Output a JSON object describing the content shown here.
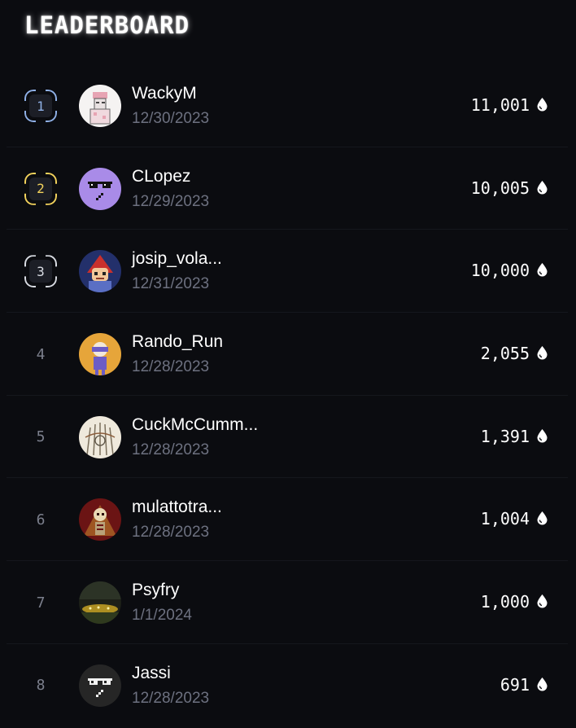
{
  "header": {
    "title": "LEADERBOARD"
  },
  "colors": {
    "background": "#0b0c10",
    "rank1_accent": "#8fb0e6",
    "rank2_accent": "#f2d25c",
    "rank3_accent": "#d9dce3",
    "muted_text": "#6d7180"
  },
  "entries": [
    {
      "rank": "1",
      "name": "WackyM",
      "date": "12/30/2023",
      "score": "11,001",
      "avatar_icon": "pixel-character-pink-cap-avatar"
    },
    {
      "rank": "2",
      "name": "CLopez",
      "date": "12/29/2023",
      "score": "10,005",
      "avatar_icon": "purple-sunglasses-face-avatar"
    },
    {
      "rank": "3",
      "name": "josip_vola...",
      "date": "12/31/2023",
      "score": "10,000",
      "avatar_icon": "cartoon-character-blue-avatar"
    },
    {
      "rank": "4",
      "name": "Rando_Run",
      "date": "12/28/2023",
      "score": "2,055",
      "avatar_icon": "orange-vr-figure-avatar"
    },
    {
      "rank": "5",
      "name": "CuckMcCumm...",
      "date": "12/28/2023",
      "score": "1,391",
      "avatar_icon": "sketch-illustration-avatar"
    },
    {
      "rank": "6",
      "name": "mulattotra...",
      "date": "12/28/2023",
      "score": "1,004",
      "avatar_icon": "skeleton-red-avatar"
    },
    {
      "rank": "7",
      "name": "Psyfry",
      "date": "1/1/2024",
      "score": "1,000",
      "avatar_icon": "night-scene-lights-avatar"
    },
    {
      "rank": "8",
      "name": "Jassi",
      "date": "12/28/2023",
      "score": "691",
      "avatar_icon": "dark-sunglasses-face-avatar"
    }
  ],
  "score_icon": "drop-icon"
}
